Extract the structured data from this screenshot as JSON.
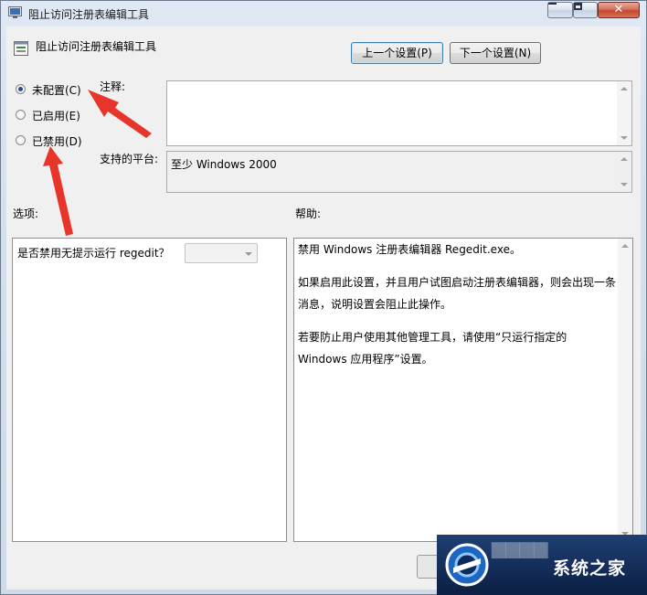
{
  "window": {
    "title": "阻止访问注册表编辑工具",
    "close_glyph": "✕"
  },
  "header": {
    "policy_title": "阻止访问注册表编辑工具",
    "prev_button": "上一个设置(P)",
    "next_button": "下一个设置(N)"
  },
  "state": {
    "options": [
      {
        "label": "未配置(C)",
        "checked": true
      },
      {
        "label": "已启用(E)",
        "checked": false
      },
      {
        "label": "已禁用(D)",
        "checked": false
      }
    ]
  },
  "comment": {
    "label": "注释:",
    "value": ""
  },
  "platform": {
    "label": "支持的平台:",
    "value": "至少 Windows 2000"
  },
  "options_section": {
    "label": "选项:",
    "item_label": "是否禁用无提示运行 regedit？",
    "dropdown_value": ""
  },
  "help_section": {
    "label": "帮助:",
    "paragraphs": [
      "禁用 Windows 注册表编辑器 Regedit.exe。",
      "如果启用此设置，并且用户试图启动注册表编辑器，则会出现一条消息，说明设置会阻止此操作。",
      "若要防止用户使用其他管理工具，请使用“只运行指定的 Windows 应用程序”设置。"
    ]
  },
  "watermark": {
    "text": "系统之家"
  },
  "colors": {
    "annotation_arrow": "#e8352b",
    "selected_button_border": "#3c7fb1"
  }
}
